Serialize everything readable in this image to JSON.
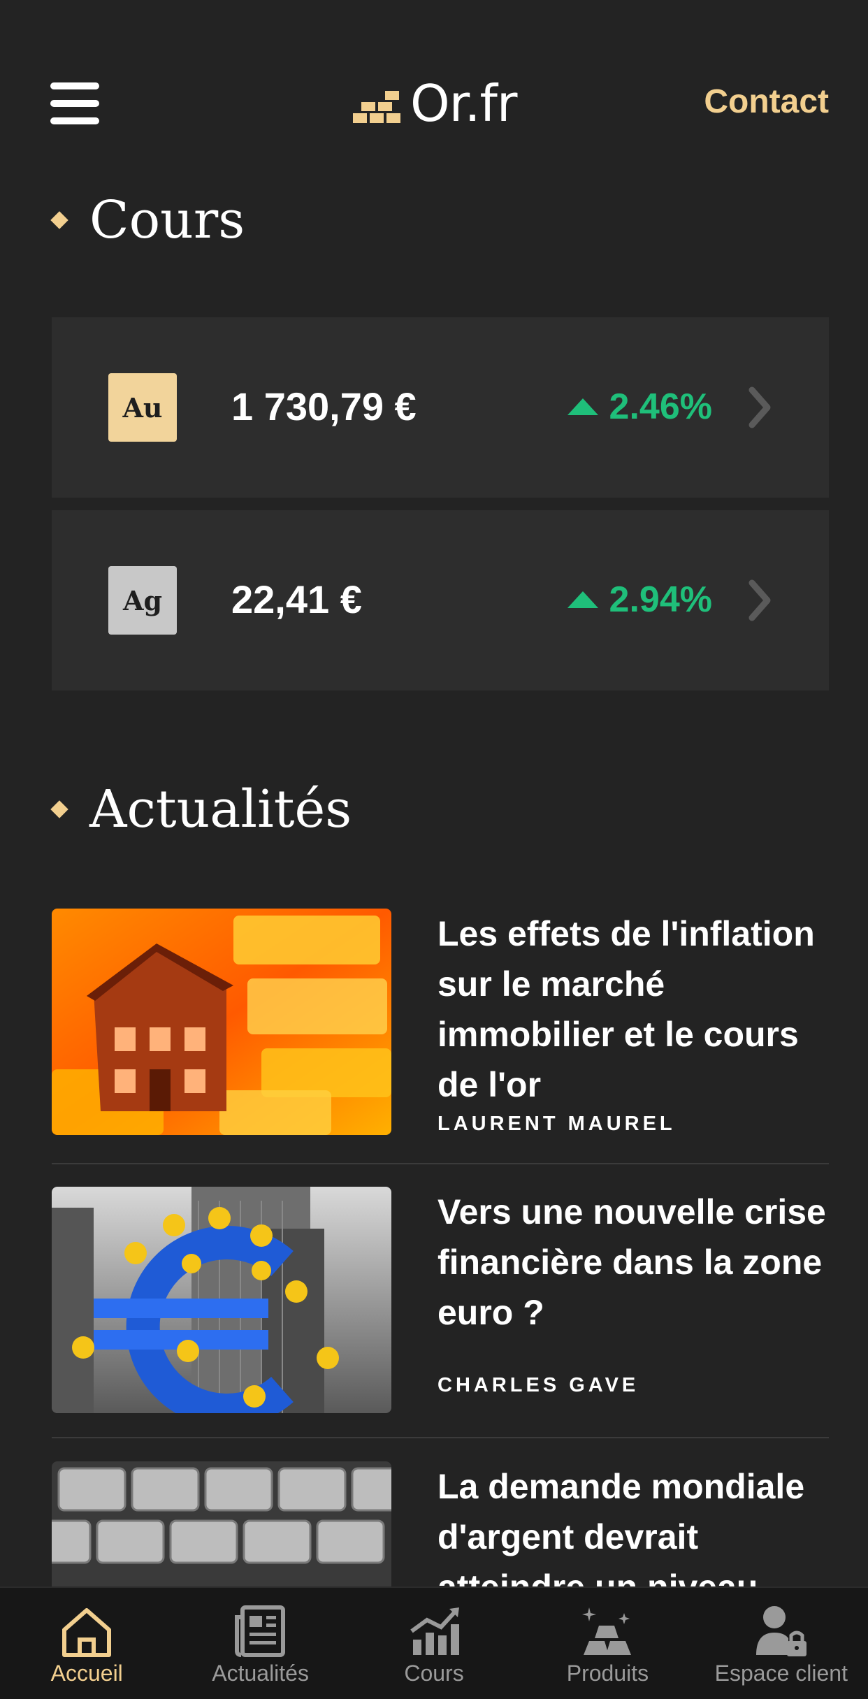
{
  "header": {
    "logo_text": "Or.fr",
    "contact_label": "Contact"
  },
  "cours": {
    "title": "Cours",
    "rates": [
      {
        "symbol": "Au",
        "price": "1 730,79 €",
        "change": "2.46%",
        "badge_color": "#f2d49b"
      },
      {
        "symbol": "Ag",
        "price": "22,41 €",
        "change": "2.94%",
        "badge_color": "#c8c8c8"
      }
    ]
  },
  "actualites": {
    "title": "Actualités",
    "articles": [
      {
        "title": "Les effets de l'inflation sur le marché immobilier et le cours de l'or",
        "author": "LAURENT MAUREL"
      },
      {
        "title": "Vers une nouvelle crise financière dans la zone euro ?",
        "author": "CHARLES GAVE"
      },
      {
        "title": "La demande mondiale d'argent devrait atteindre un niveau",
        "author": ""
      }
    ]
  },
  "tabbar": {
    "tabs": [
      {
        "label": "Accueil",
        "icon": "home-icon"
      },
      {
        "label": "Actualités",
        "icon": "newspaper-icon"
      },
      {
        "label": "Cours",
        "icon": "chart-icon"
      },
      {
        "label": "Produits",
        "icon": "gold-bars-icon"
      },
      {
        "label": "Espace client",
        "icon": "user-lock-icon"
      }
    ]
  },
  "colors": {
    "accent": "#f2cf8f",
    "positive": "#1fbf7a",
    "background": "#232323",
    "card": "#2d2d2d"
  }
}
